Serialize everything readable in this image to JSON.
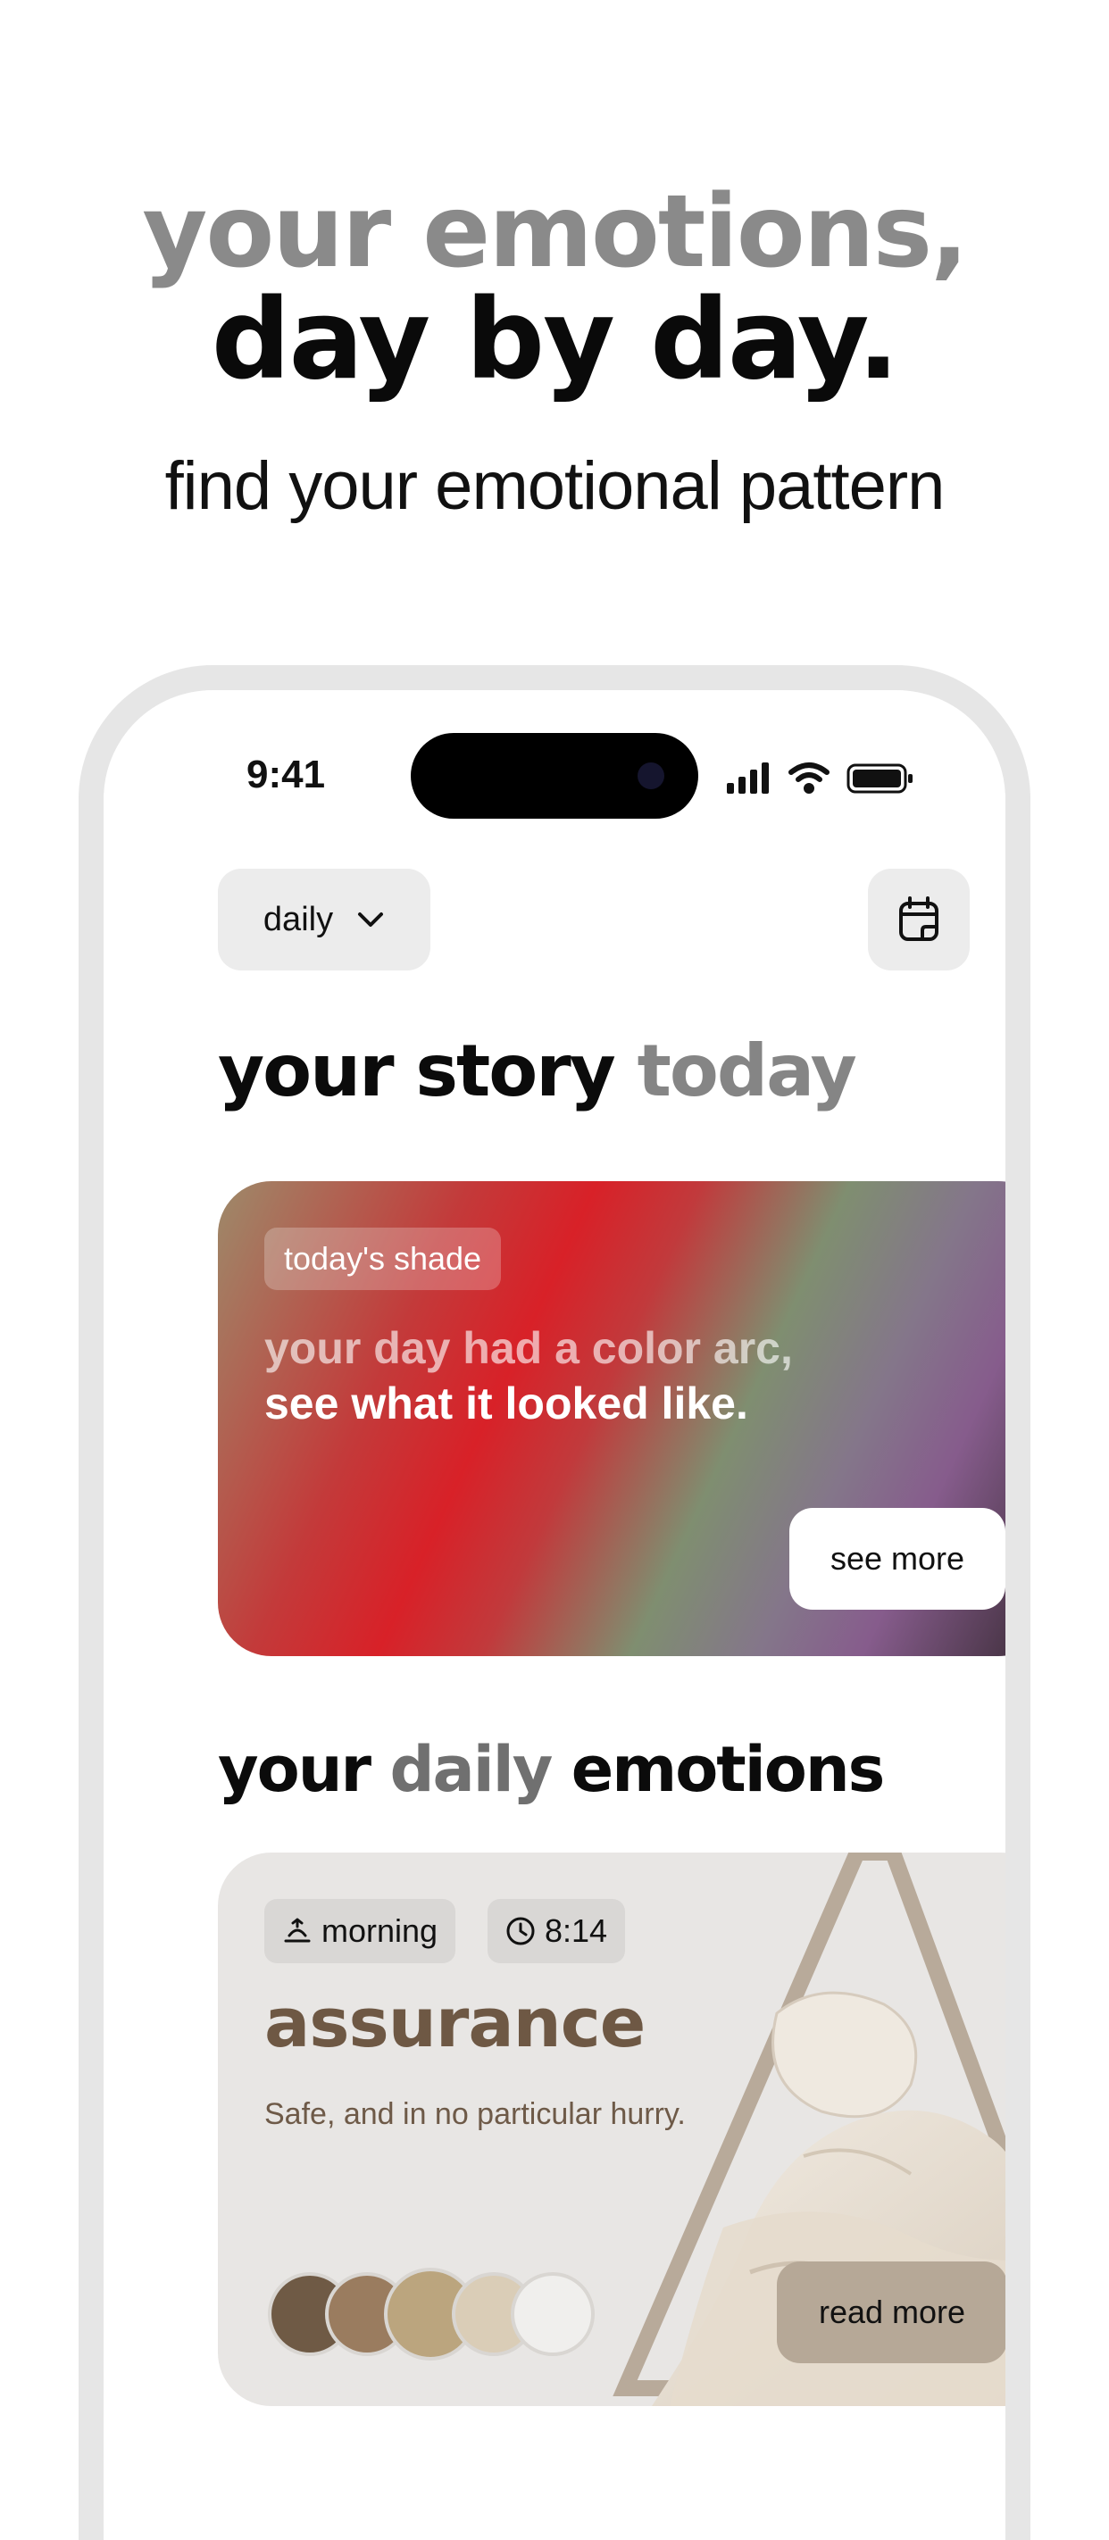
{
  "hero": {
    "line1": "your emotions,",
    "line2": "day by day.",
    "subtitle": "find your emotional pattern"
  },
  "status_bar": {
    "time": "9:41"
  },
  "toolbar": {
    "period_label": "daily",
    "calendar_icon": "calendar-icon"
  },
  "story": {
    "title_main": "your story",
    "title_accent": "today"
  },
  "shade_card": {
    "pill": "today's shade",
    "line1": "your day had a color arc,",
    "line2": "see what it looked like.",
    "button": "see more"
  },
  "emotions_section": {
    "title_part1": "your",
    "title_accent": "daily",
    "title_part2": "emotions"
  },
  "emotion_card": {
    "time_of_day": "morning",
    "time": "8:14",
    "name": "assurance",
    "description": "Safe, and in no particular hurry.",
    "button": "read more",
    "swatches": [
      "#6f5a45",
      "#9a7c5f",
      "#bba57e",
      "#dacdb7",
      "#f0efed"
    ]
  },
  "colors": {
    "accent_brown": "#6e5844",
    "muted_gray": "#858585"
  }
}
